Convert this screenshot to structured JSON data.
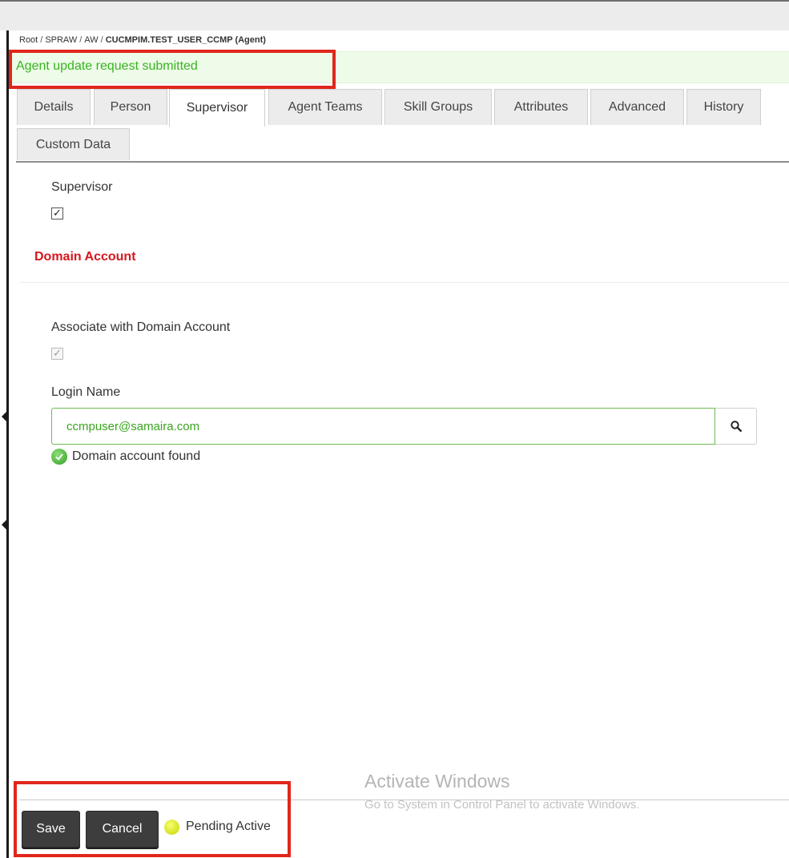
{
  "breadcrumb": {
    "parts": [
      "Root",
      "SPRAW",
      "AW"
    ],
    "separator": "/",
    "current": "CUCMPIM.TEST_USER_CCMP (Agent)"
  },
  "alert": {
    "message": "Agent update request submitted",
    "color": "#37b51e"
  },
  "tabs": [
    {
      "label": "Details"
    },
    {
      "label": "Person"
    },
    {
      "label": "Supervisor",
      "active": true
    },
    {
      "label": "Agent Teams"
    },
    {
      "label": "Skill Groups"
    },
    {
      "label": "Attributes"
    },
    {
      "label": "Advanced"
    },
    {
      "label": "History"
    },
    {
      "label": "Custom Data"
    }
  ],
  "supervisor": {
    "label": "Supervisor",
    "checked": true
  },
  "domain_account": {
    "title": "Domain Account",
    "title_color": "#d8161b",
    "associate_label": "Associate with Domain Account",
    "associate_checked": true,
    "login_label": "Login Name",
    "login_value": "ccmpuser@samaira.com",
    "search_icon": "search-icon",
    "status_icon": "check-circle-icon",
    "status_text": "Domain account found"
  },
  "footer": {
    "save_label": "Save",
    "cancel_label": "Cancel",
    "status_icon": "yellow-dot-icon",
    "status_text": "Pending Active"
  },
  "watermark": {
    "title": "Activate Windows",
    "subtitle": "Go to System in Control Panel to activate Windows."
  },
  "highlight_color": "#e0261b"
}
